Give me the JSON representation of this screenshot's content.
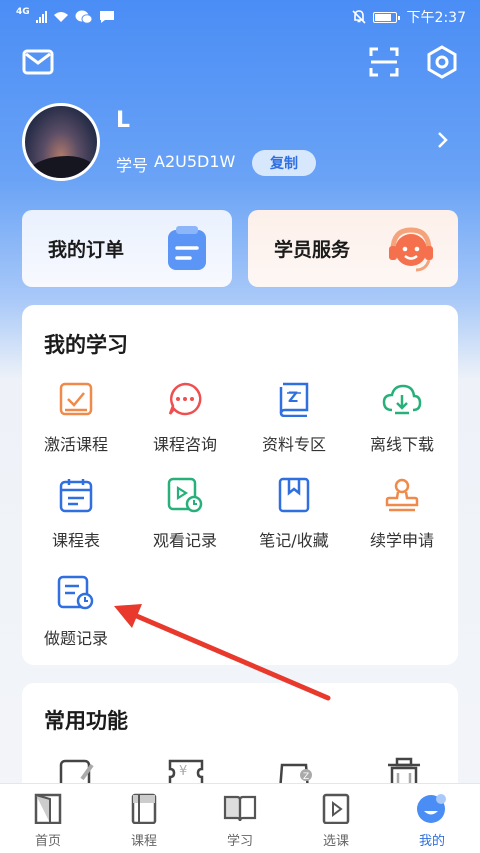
{
  "status_bar": {
    "network": "4G",
    "time": "下午2:37"
  },
  "profile": {
    "name": "L",
    "student_id_label": "学号",
    "student_id": "A2U5D1W",
    "copy_label": "复制"
  },
  "quick_cards": {
    "orders_label": "我的订单",
    "service_label": "学员服务"
  },
  "my_learning": {
    "title": "我的学习",
    "items": [
      {
        "label": "激活课程",
        "icon": "activate-course-icon"
      },
      {
        "label": "课程咨询",
        "icon": "chat-bubble-icon"
      },
      {
        "label": "资料专区",
        "icon": "book-icon"
      },
      {
        "label": "离线下载",
        "icon": "cloud-download-icon"
      },
      {
        "label": "课程表",
        "icon": "calendar-icon"
      },
      {
        "label": "观看记录",
        "icon": "play-history-icon"
      },
      {
        "label": "笔记/收藏",
        "icon": "bookmark-icon"
      },
      {
        "label": "续学申请",
        "icon": "stamp-icon"
      },
      {
        "label": "做题记录",
        "icon": "exercise-record-icon"
      }
    ]
  },
  "common": {
    "title": "常用功能"
  },
  "bottom_nav": {
    "items": [
      {
        "label": "首页",
        "icon": "home-door-icon"
      },
      {
        "label": "课程",
        "icon": "course-book-icon"
      },
      {
        "label": "学习",
        "icon": "open-book-icon"
      },
      {
        "label": "选课",
        "icon": "play-video-icon"
      },
      {
        "label": "我的",
        "icon": "profile-face-icon"
      }
    ],
    "active_index": 4
  },
  "colors": {
    "primary": "#2f6fe0",
    "orange": "#f08a4b",
    "green": "#28b07a",
    "annotation_red": "#e8392c"
  }
}
